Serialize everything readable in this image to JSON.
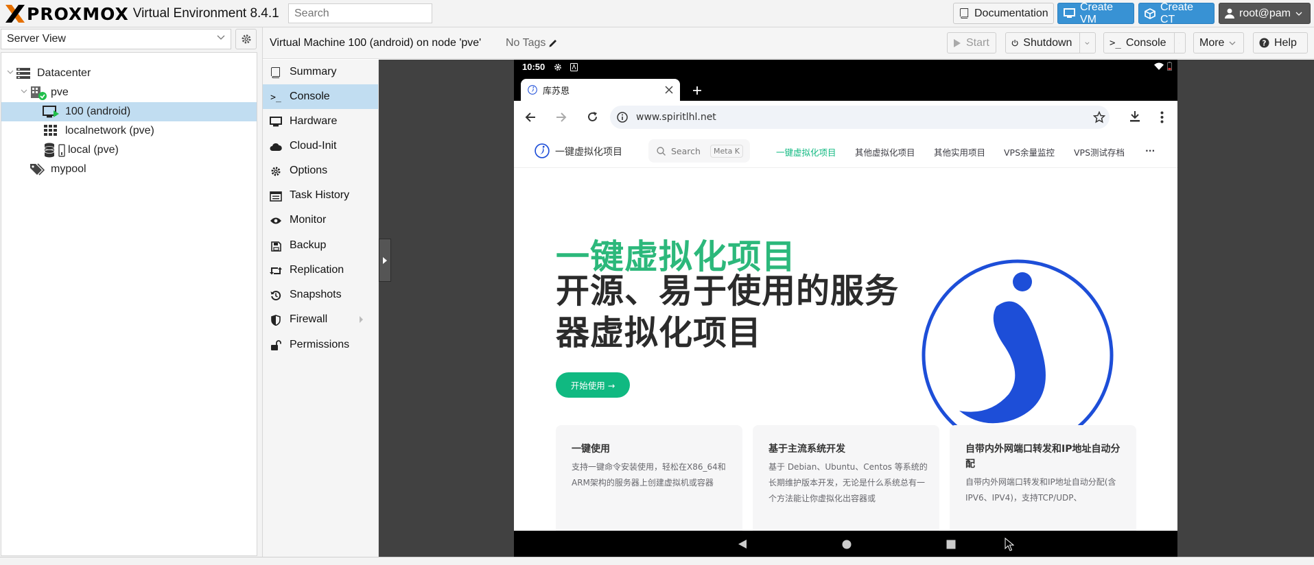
{
  "header": {
    "logo_text": "PROXMOX",
    "product": "Virtual Environment 8.4.1",
    "search_placeholder": "Search",
    "buttons": {
      "documentation": "Documentation",
      "create_vm": "Create VM",
      "create_ct": "Create CT",
      "user": "root@pam"
    }
  },
  "tree": {
    "view": "Server View",
    "items": [
      {
        "label": "Datacenter"
      },
      {
        "label": "pve"
      },
      {
        "label": "100 (android)"
      },
      {
        "label": "localnetwork (pve)"
      },
      {
        "label": "local (pve)"
      },
      {
        "label": "mypool"
      }
    ]
  },
  "toolbar": {
    "title": "Virtual Machine 100 (android) on node 'pve'",
    "tags": "No Tags",
    "start": "Start",
    "shutdown": "Shutdown",
    "console": "Console",
    "more": "More",
    "help": "Help"
  },
  "nav": {
    "items": [
      {
        "label": "Summary"
      },
      {
        "label": "Console"
      },
      {
        "label": "Hardware"
      },
      {
        "label": "Cloud-Init"
      },
      {
        "label": "Options"
      },
      {
        "label": "Task History"
      },
      {
        "label": "Monitor"
      },
      {
        "label": "Backup"
      },
      {
        "label": "Replication"
      },
      {
        "label": "Snapshots"
      },
      {
        "label": "Firewall"
      },
      {
        "label": "Permissions"
      }
    ],
    "selected": "Console"
  },
  "android": {
    "time": "10:50",
    "tab_title": "库苏恩",
    "url": "www.spiritlhl.net",
    "site": {
      "brand": "一键虚拟化项目",
      "search": "Search",
      "search_key": "Meta K",
      "nav_links": [
        "一键虚拟化项目",
        "其他虚拟化项目",
        "其他实用项目",
        "VPS余量监控",
        "VPS测试存档",
        "···"
      ],
      "hero_title": "一键虚拟化项目",
      "hero_subtitle": "开源、易于使用的服务器虚拟化项目",
      "start_button": "开始使用 →",
      "cards": [
        {
          "title": "一键使用",
          "desc": "支持一键命令安装使用，轻松在X86_64和ARM架构的服务器上创建虚拟机或容器"
        },
        {
          "title": "基于主流系统开发",
          "desc": "基于 Debian、Ubuntu、Centos 等系统的长期维护版本开发，无论是什么系统总有一个方法能让你虚拟化出容器或"
        },
        {
          "title": "自带内外网端口转发和IP地址自动分配",
          "desc": "自带内外网端口转发和IP地址自动分配(含IPV6、IPV4)，支持TCP/UDP、"
        }
      ]
    }
  },
  "colors": {
    "accent": "#3892d4",
    "selection": "#c1ddf1",
    "site_green": "#10b981",
    "logo_orange": "#e57000"
  }
}
